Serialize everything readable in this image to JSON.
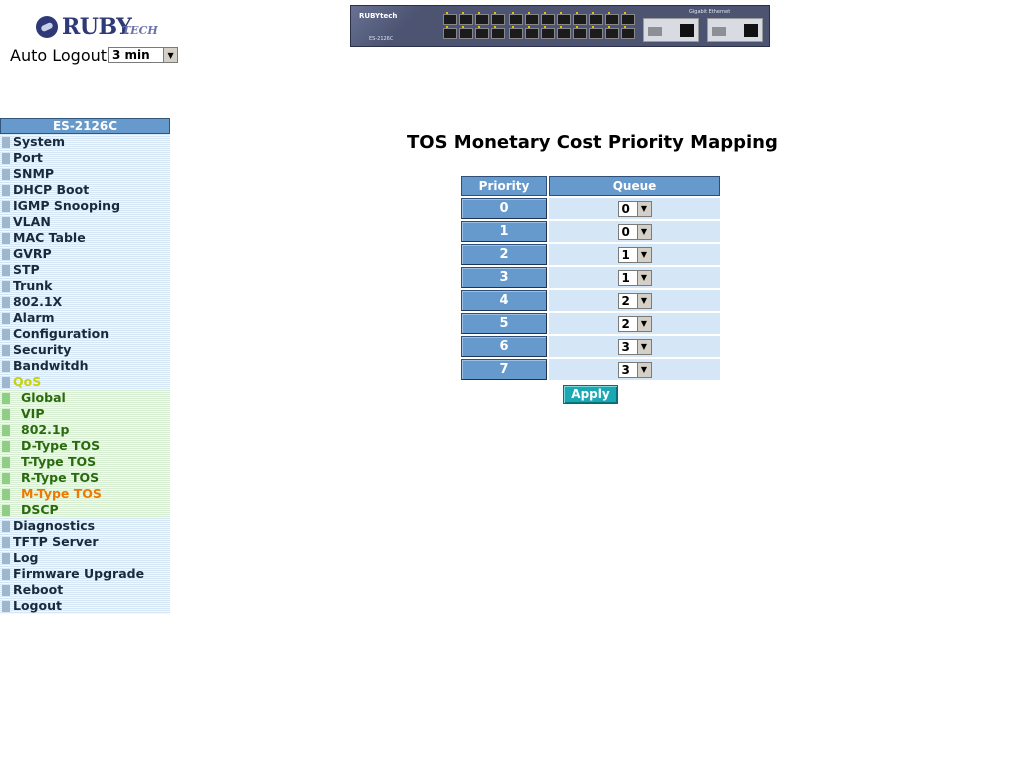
{
  "header": {
    "logo_word": "RUBY",
    "logo_suffix": "TECH",
    "auto_logout_label": "Auto Logout",
    "auto_logout_value": "3 min"
  },
  "banner": {
    "brand": "RUBYtech",
    "model": "ES-2126C",
    "gigabit": "Gigabit Ethernet"
  },
  "sidebar": {
    "title": "ES-2126C",
    "items": [
      {
        "label": "System",
        "type": "main"
      },
      {
        "label": "Port",
        "type": "main"
      },
      {
        "label": "SNMP",
        "type": "main"
      },
      {
        "label": "DHCP Boot",
        "type": "main"
      },
      {
        "label": "IGMP Snooping",
        "type": "main"
      },
      {
        "label": "VLAN",
        "type": "main"
      },
      {
        "label": "MAC Table",
        "type": "main"
      },
      {
        "label": "GVRP",
        "type": "main"
      },
      {
        "label": "STP",
        "type": "main"
      },
      {
        "label": "Trunk",
        "type": "main"
      },
      {
        "label": "802.1X",
        "type": "main"
      },
      {
        "label": "Alarm",
        "type": "main"
      },
      {
        "label": "Configuration",
        "type": "main"
      },
      {
        "label": "Security",
        "type": "main"
      },
      {
        "label": "Bandwitdh",
        "type": "main"
      },
      {
        "label": "QoS",
        "type": "main-open"
      },
      {
        "label": "Global",
        "type": "sub"
      },
      {
        "label": "VIP",
        "type": "sub"
      },
      {
        "label": "802.1p",
        "type": "sub"
      },
      {
        "label": "D-Type TOS",
        "type": "sub"
      },
      {
        "label": "T-Type TOS",
        "type": "sub"
      },
      {
        "label": "R-Type TOS",
        "type": "sub"
      },
      {
        "label": "M-Type TOS",
        "type": "sub-active"
      },
      {
        "label": "DSCP",
        "type": "sub"
      },
      {
        "label": "Diagnostics",
        "type": "main"
      },
      {
        "label": "TFTP Server",
        "type": "main"
      },
      {
        "label": "Log",
        "type": "main"
      },
      {
        "label": "Firmware Upgrade",
        "type": "main"
      },
      {
        "label": "Reboot",
        "type": "main"
      },
      {
        "label": "Logout",
        "type": "main"
      }
    ]
  },
  "main": {
    "title": "TOS Monetary Cost Priority Mapping",
    "table": {
      "headers": [
        "Priority",
        "Queue"
      ],
      "rows": [
        {
          "priority": "0",
          "queue": "0"
        },
        {
          "priority": "1",
          "queue": "0"
        },
        {
          "priority": "2",
          "queue": "1"
        },
        {
          "priority": "3",
          "queue": "1"
        },
        {
          "priority": "4",
          "queue": "2"
        },
        {
          "priority": "5",
          "queue": "2"
        },
        {
          "priority": "6",
          "queue": "3"
        },
        {
          "priority": "7",
          "queue": "3"
        }
      ]
    },
    "apply_label": "Apply"
  },
  "colors": {
    "header_blue": "#6699cc",
    "apply_teal": "#1aa9b4",
    "active_orange": "#f07800",
    "qos_open": "#c8d400",
    "sub_green": "#2a6a0e"
  }
}
